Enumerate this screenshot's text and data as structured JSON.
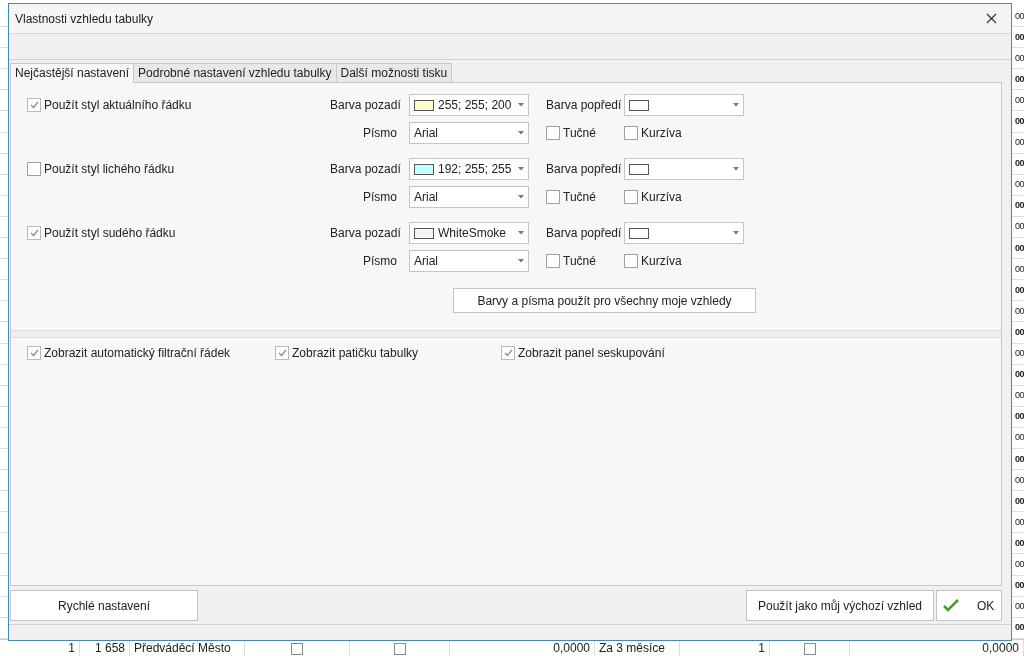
{
  "background": {
    "right_cells": [
      "00",
      "00",
      "00",
      "00",
      "00",
      "00",
      "00",
      "00",
      "00",
      "00",
      "00",
      "00",
      "00",
      "00",
      "00",
      "00",
      "00",
      "00",
      "00",
      "00",
      "00",
      "00",
      "00",
      "00",
      "00",
      "00",
      "00",
      "00",
      "00",
      "00"
    ],
    "last_row": {
      "number": "1",
      "code": "1 658",
      "name": "Předváděcí Město",
      "check_1": false,
      "check_2": false,
      "amount": "0,0000",
      "period": "Za 3 měsíce",
      "count": "1",
      "check_3": false,
      "total": "0,0000"
    }
  },
  "dialog": {
    "title": "Vlastnosti vzhledu tabulky",
    "tabs": [
      {
        "label": "Nejčastější nastavení",
        "selected": true
      },
      {
        "label": "Podrobné nastavení vzhledu tabulky",
        "selected": false
      },
      {
        "label": "Další možnosti tisku",
        "selected": false
      }
    ],
    "style_rows": [
      {
        "label": "Použít styl aktuálního řádku",
        "checked": true,
        "background_label": "Barva pozadí",
        "background_value": "255; 255; 200",
        "color": "#ffffc8",
        "foreground_label": "Barva popředí",
        "font_label": "Písmo",
        "font_value": "Arial",
        "bold_label": "Tučné",
        "bold": false,
        "italic_label": "Kurzíva",
        "italic": false
      },
      {
        "label": "Použít styl lichého řádku",
        "checked": false,
        "background_label": "Barva pozadí",
        "background_value": "192; 255; 255",
        "color": "#c0ffff",
        "foreground_label": "Barva popředí",
        "font_label": "Písmo",
        "font_value": "Arial",
        "bold_label": "Tučné",
        "bold": false,
        "italic_label": "Kurzíva",
        "italic": false
      },
      {
        "label": "Použít styl sudého řádku",
        "checked": true,
        "background_label": "Barva pozadí",
        "background_value": "WhiteSmoke",
        "color": "#f5f5f5",
        "foreground_label": "Barva popředí",
        "font_label": "Písmo",
        "font_value": "Arial",
        "bold_label": "Tučné",
        "bold": false,
        "italic_label": "Kurzíva",
        "italic": false
      }
    ],
    "apply_all_button": "Barvy a písma použít pro všechny moje vzhledy",
    "options": [
      {
        "label": "Zobrazit automatický filtrační řádek",
        "checked": true
      },
      {
        "label": "Zobrazit patičku tabulky",
        "checked": true
      },
      {
        "label": "Zobrazit panel seskupování",
        "checked": true
      }
    ],
    "quick_button": "Rychlé nastavení",
    "default_button": "Použít jako můj výchozí vzhled",
    "ok_button": "OK"
  }
}
